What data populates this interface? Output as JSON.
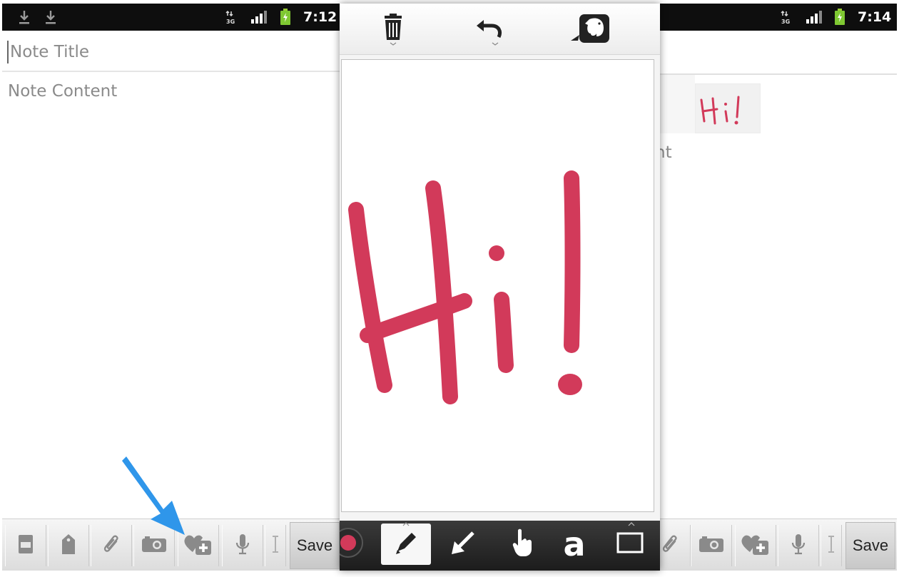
{
  "left_screen": {
    "status": {
      "clock": "7:12"
    },
    "note": {
      "title_placeholder": "Note Title",
      "content_placeholder": "Note Content"
    },
    "toolbar": {
      "save_label": "Save"
    }
  },
  "middle_screen": {
    "sketch_text": "Hi!",
    "ink_color": "#d23a5a",
    "tools": {
      "text_tool_glyph": "a"
    }
  },
  "right_screen": {
    "status": {
      "clock": "7:14"
    },
    "content_fragment": "nt",
    "toolbar": {
      "save_label": "Save"
    }
  },
  "colors": {
    "arrow": "#2f96ea",
    "statusbar": "#0e0e0e"
  }
}
